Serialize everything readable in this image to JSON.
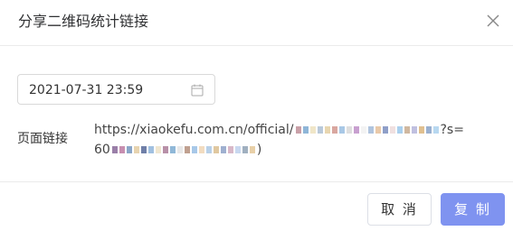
{
  "dialog": {
    "title": "分享二维码统计链接",
    "close_icon": "close-icon"
  },
  "date_field": {
    "value": "2021-07-31 23:59",
    "icon": "calendar-icon"
  },
  "link": {
    "label": "页面链接",
    "line1_prefix": "https://xiaokefu.com.cn/official/",
    "line1_suffix": "?s=",
    "line2_prefix": "60",
    "line2_suffix": ")"
  },
  "buttons": {
    "cancel": "取 消",
    "copy": "复 制"
  },
  "colors": {
    "primary": "#7f93f0",
    "border": "#dcdfe6"
  }
}
